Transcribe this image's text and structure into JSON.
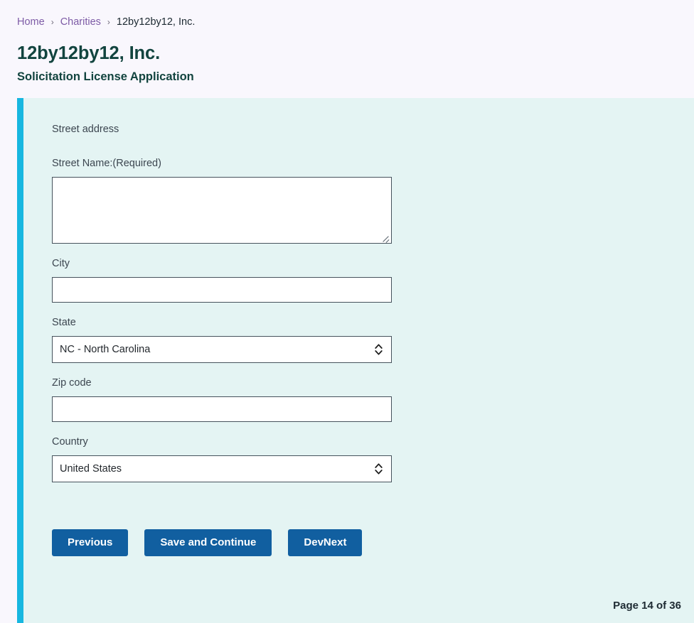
{
  "breadcrumb": {
    "separator": "›",
    "items": [
      {
        "label": "Home",
        "type": "link"
      },
      {
        "label": "Charities",
        "type": "link"
      },
      {
        "label": "12by12by12, Inc.",
        "type": "current"
      }
    ]
  },
  "header": {
    "title": "12by12by12, Inc.",
    "subtitle": "Solicitation License Application"
  },
  "form": {
    "section_heading": "Street address",
    "fields": {
      "street_name": {
        "label": "Street Name:(Required)",
        "value": "",
        "placeholder": ""
      },
      "city": {
        "label": "City",
        "value": "",
        "placeholder": ""
      },
      "state": {
        "label": "State",
        "value": "NC - North Carolina",
        "options": [
          "NC - North Carolina"
        ]
      },
      "zip_code": {
        "label": "Zip code",
        "value": "",
        "placeholder": ""
      },
      "country": {
        "label": "Country",
        "value": "United States",
        "options": [
          "United States"
        ]
      }
    }
  },
  "actions": {
    "previous": "Previous",
    "save_and_continue": "Save and Continue",
    "dev_next": "DevNext"
  },
  "footer": {
    "page_counter": "Page 14 of 36"
  },
  "colors": {
    "page_background": "#f9f7fd",
    "panel_background": "#e4f4f3",
    "panel_accent": "#17b7e0",
    "title": "#12443f",
    "breadcrumb_link": "#7d5ba6",
    "button": "#115fa0",
    "input_border": "#46525c"
  }
}
